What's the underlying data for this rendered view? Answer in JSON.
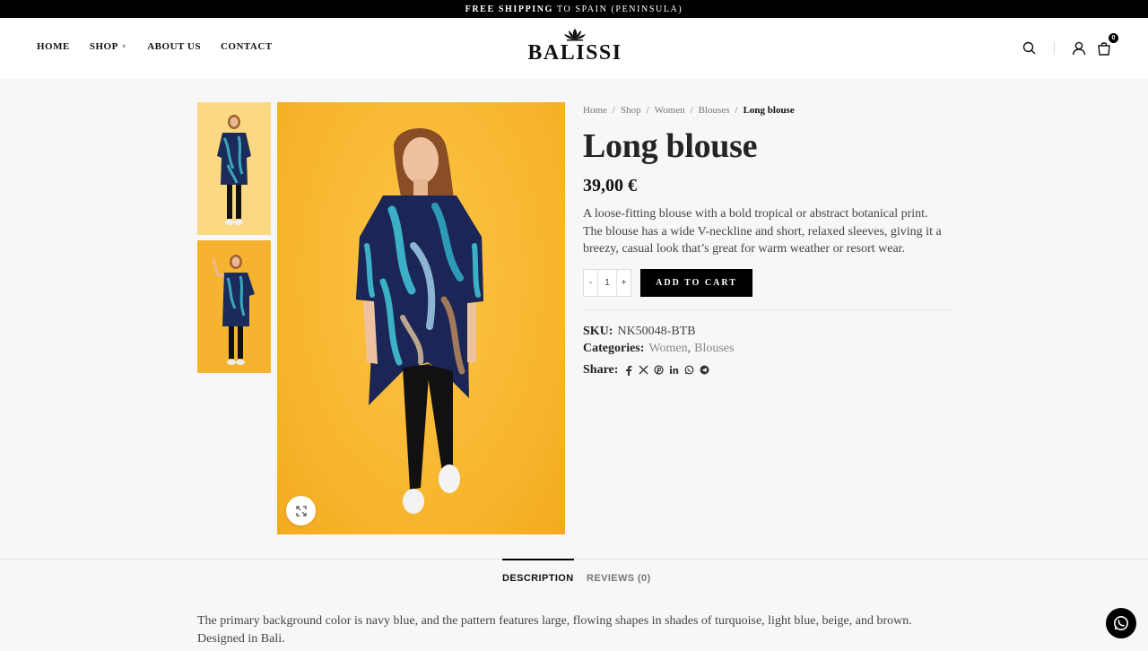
{
  "topbar": {
    "bold": "Free shipping",
    "rest": "to Spain (Peninsula)"
  },
  "nav": {
    "home": "Home",
    "shop": "Shop",
    "about": "About us",
    "contact": "Contact"
  },
  "logo": {
    "text": "BALISSI"
  },
  "header": {
    "cart_count": "0"
  },
  "breadcrumb": {
    "home": "Home",
    "shop": "Shop",
    "women": "Women",
    "blouses": "Blouses",
    "current": "Long blouse",
    "sep": "/"
  },
  "product": {
    "title": "Long blouse",
    "price": "39,00 €",
    "description": "A loose-fitting blouse with a bold tropical or abstract botanical print. The blouse has a wide V-neckline and short, relaxed sleeves, giving it a breezy, casual look that’s great for warm weather or resort wear.",
    "qty_minus": "-",
    "qty_value": "1",
    "qty_plus": "+",
    "add_to_cart": "Add to cart",
    "sku_label": "SKU:",
    "sku": "NK50048-BTB",
    "categories_label": "Categories:",
    "category_1": "Women",
    "category_sep": ",",
    "category_2": "Blouses",
    "share_label": "Share:"
  },
  "tabs": {
    "description": "Description",
    "reviews": "Reviews (0)"
  },
  "long_description": "The primary background color is navy blue, and the pattern features large, flowing shapes in shades of turquoise, light blue, beige, and brown. Designed in Bali.",
  "colors": {
    "accent": "#000000",
    "image_bg": "#f7b42c",
    "page_bg": "#f7f7f7"
  },
  "icons": [
    "search-icon",
    "user-icon",
    "cart-icon",
    "expand-icon",
    "facebook-icon",
    "x-icon",
    "pinterest-icon",
    "linkedin-icon",
    "whatsapp-icon",
    "telegram-icon"
  ]
}
